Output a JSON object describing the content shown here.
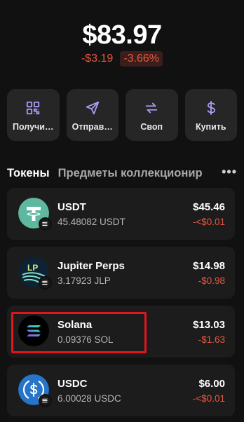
{
  "balance": {
    "total": "$83.97",
    "change_abs": "-$3.19",
    "change_pct": "-3.66%"
  },
  "actions": [
    {
      "label": "Получи…",
      "icon": "qr-code-icon"
    },
    {
      "label": "Отправ…",
      "icon": "send-icon"
    },
    {
      "label": "Своп",
      "icon": "swap-icon"
    },
    {
      "label": "Купить",
      "icon": "dollar-icon"
    }
  ],
  "tabs": {
    "active": "Токены",
    "inactive": "Предметы коллекционир",
    "more": "•••"
  },
  "tokens": [
    {
      "name": "USDT",
      "amount": "45.48082 USDT",
      "value": "$45.46",
      "change": "-<$0.01",
      "icon": "tether-icon",
      "color": "#26a17b"
    },
    {
      "name": "Jupiter Perps",
      "amount": "3.17923 JLP",
      "value": "$14.98",
      "change": "-$0.98",
      "icon": "jlp-icon",
      "color": "#0e2233"
    },
    {
      "name": "Solana",
      "amount": "0.09376 SOL",
      "value": "$13.03",
      "change": "-$1.63",
      "icon": "solana-icon",
      "color": "#000000"
    },
    {
      "name": "USDC",
      "amount": "6.00028 USDC",
      "value": "$6.00",
      "change": "-<$0.01",
      "icon": "usdc-icon",
      "color": "#2775ca"
    }
  ],
  "colors": {
    "negative": "#e8583f",
    "highlight": "#e0161c",
    "card": "#1c1c1c",
    "action_bg": "#262626"
  }
}
